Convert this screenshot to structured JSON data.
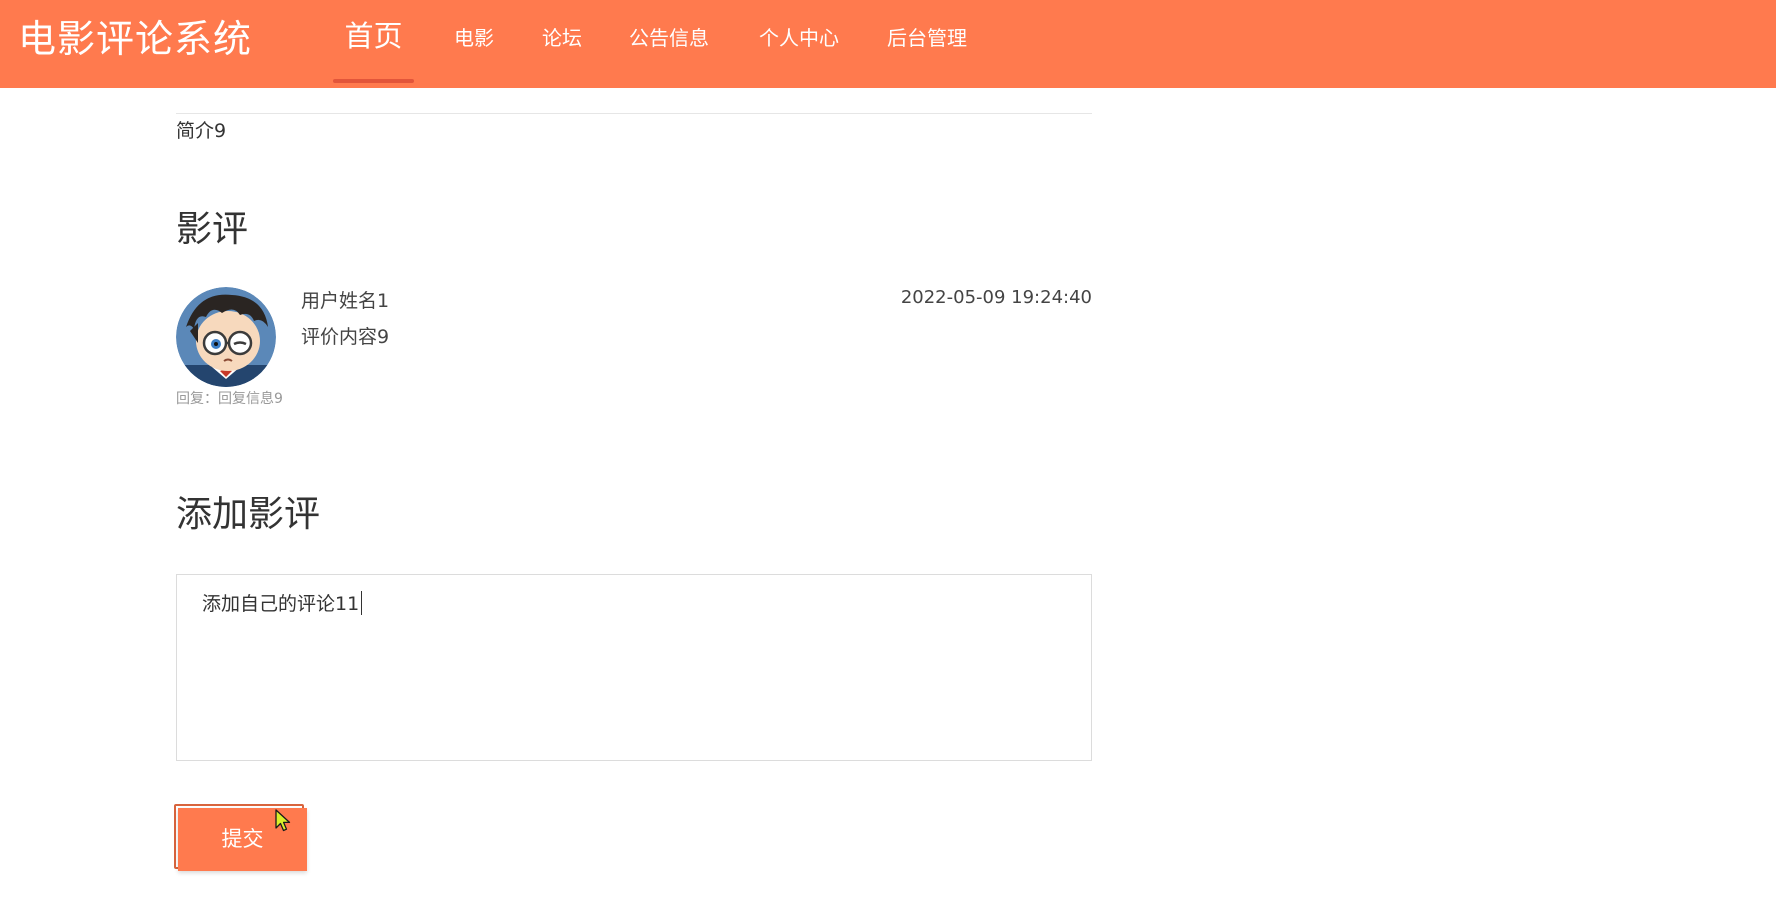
{
  "header": {
    "brand": "电影评论系统",
    "nav": [
      {
        "label": "首页",
        "active": true
      },
      {
        "label": "电影",
        "active": false
      },
      {
        "label": "论坛",
        "active": false
      },
      {
        "label": "公告信息",
        "active": false
      },
      {
        "label": "个人中心",
        "active": false
      },
      {
        "label": "后台管理",
        "active": false
      }
    ]
  },
  "movie": {
    "intro": "简介9"
  },
  "reviews": {
    "title": "影评",
    "items": [
      {
        "username": "用户姓名1",
        "content": "评价内容9",
        "time": "2022-05-09 19:24:40",
        "reply_label": "回复：",
        "reply_text": "回复信息9"
      }
    ]
  },
  "add_review": {
    "title": "添加影评",
    "input_value": "添加自己的评论11",
    "submit_label": "提交"
  },
  "colors": {
    "accent": "#ff7a4e",
    "accent_dark": "#e2553a",
    "text": "#333333",
    "muted": "#999999"
  }
}
